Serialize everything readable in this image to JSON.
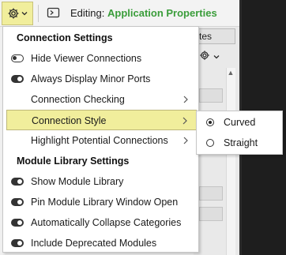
{
  "toolbar": {
    "gear_icon": "gear-icon",
    "dropdown_icon": "chevron-down-icon",
    "edit_icon": "edit-window-icon",
    "editing_label": "Editing:",
    "editing_target": "Application Properties"
  },
  "background": {
    "tab_label": "tes",
    "bottom_text": "··· ···"
  },
  "menu": {
    "sections": [
      {
        "header": "Connection Settings"
      },
      {
        "header": "Module Library Settings"
      }
    ],
    "items": [
      {
        "label": "Hide Viewer Connections",
        "toggle": "off",
        "submenu": false
      },
      {
        "label": "Always Display Minor Ports",
        "toggle": "on",
        "submenu": false
      },
      {
        "label": "Connection Checking",
        "toggle": null,
        "submenu": true
      },
      {
        "label": "Connection Style",
        "toggle": null,
        "submenu": true,
        "highlighted": true
      },
      {
        "label": "Highlight Potential Connections",
        "toggle": null,
        "submenu": true
      },
      {
        "label": "Show Module Library",
        "toggle": "on",
        "submenu": false
      },
      {
        "label": "Pin Module Library Window Open",
        "toggle": "on",
        "submenu": false
      },
      {
        "label": "Automatically Collapse Categories",
        "toggle": "on",
        "submenu": false
      },
      {
        "label": "Include Deprecated Modules",
        "toggle": "on",
        "submenu": false
      }
    ]
  },
  "submenu": {
    "items": [
      {
        "label": "Curved",
        "selected": true
      },
      {
        "label": "Straight",
        "selected": false
      }
    ]
  },
  "colors": {
    "highlight": "#f1ee9c",
    "accent_green": "#3a9d3a",
    "dark_panel": "#1e1e1e"
  }
}
